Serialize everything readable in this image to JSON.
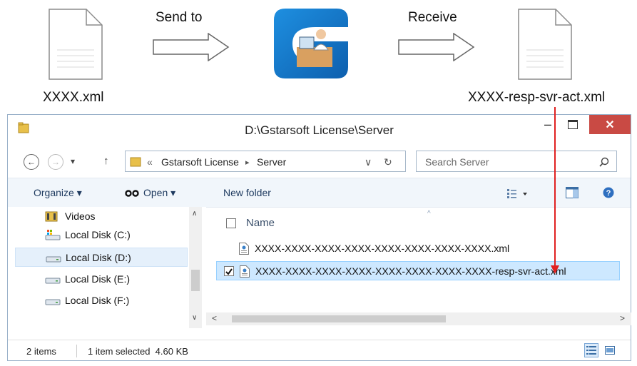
{
  "flow": {
    "send_label": "Send to",
    "receive_label": "Receive",
    "left_file": "XXXX.xml",
    "right_file": "XXXX-resp-svr-act.xml"
  },
  "window": {
    "title": "D:\\Gstarsoft License\\Server",
    "close_glyph": "✕",
    "min_glyph": "‒"
  },
  "address": {
    "chevrons": "«",
    "crumb1": "Gstarsoft License",
    "sep": "▸",
    "crumb2": "Server",
    "dropdown": "∨",
    "refresh": "↻",
    "search_placeholder": "Search Server",
    "back_glyph": "←",
    "fwd_glyph": "→",
    "history_glyph": "▾",
    "up_glyph": "↑"
  },
  "toolbar": {
    "organize": "Organize ▾",
    "open": "Open ▾",
    "new_folder": "New folder"
  },
  "nav": {
    "items": [
      {
        "label": "Videos",
        "icon": "video-folder-icon"
      },
      {
        "label": "Local Disk (C:)",
        "icon": "system-drive-icon"
      },
      {
        "label": "Local Disk (D:)",
        "icon": "drive-icon"
      },
      {
        "label": "Local Disk (E:)",
        "icon": "drive-icon"
      },
      {
        "label": "Local Disk (F:)",
        "icon": "drive-icon"
      }
    ],
    "selected": "Local Disk (D:)"
  },
  "content": {
    "column_name": "Name",
    "files": [
      {
        "name": "XXXX-XXXX-XXXX-XXXX-XXXX-XXXX-XXXX-XXXX.xml",
        "selected": false
      },
      {
        "name": "XXXX-XXXX-XXXX-XXXX-XXXX-XXXX-XXXX-XXXX-resp-svr-act.xml",
        "selected": true
      }
    ]
  },
  "status": {
    "items": "2 items",
    "selected": "1 item selected  4.60 KB"
  },
  "colors": {
    "accent_red": "#e02020",
    "close_button": "#c94a44",
    "selection": "#cde8ff",
    "logo_blue": "#1f7fd0"
  }
}
